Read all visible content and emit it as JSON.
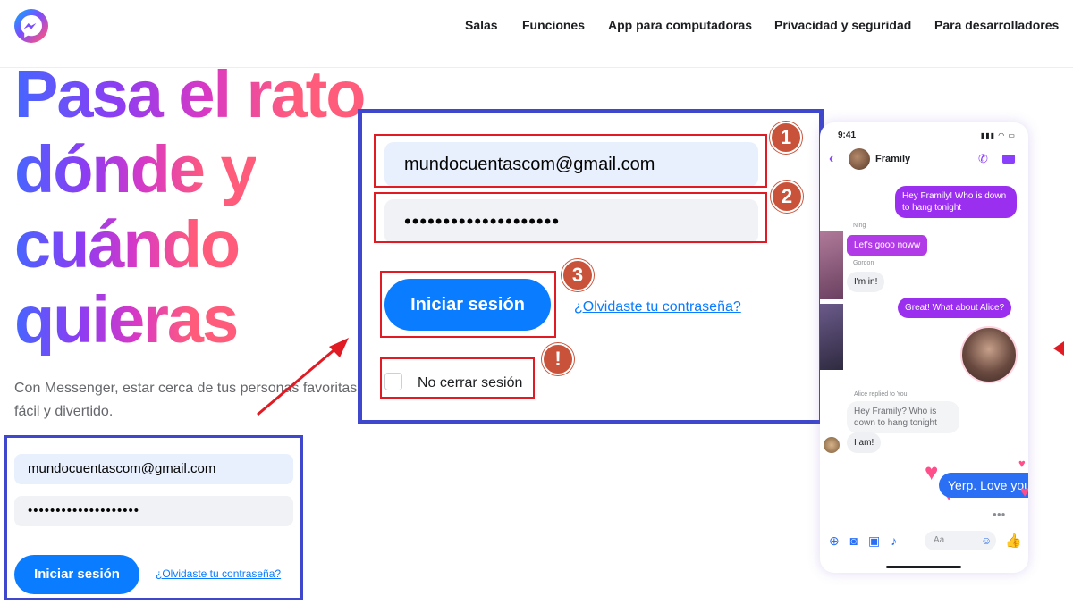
{
  "header": {
    "logo": "messenger-logo",
    "nav": [
      "Salas",
      "Funciones",
      "App para computadoras",
      "Privacidad y seguridad",
      "Para desarrolladores"
    ]
  },
  "hero": {
    "lines": [
      "Pasa el rato",
      "dónde y",
      "cuándo",
      "quieras"
    ],
    "subtitle_lines": [
      "Con Messenger, estar cerca de tus personas favoritas es",
      "fácil y divertido."
    ]
  },
  "login_small": {
    "email": "mundocuentascom@gmail.com",
    "password": "••••••••••••••••••••",
    "login_button": "Iniciar sesión",
    "forgot_link": "¿Olvidaste tu contraseña?"
  },
  "login_zoom": {
    "email": "mundocuentascom@gmail.com",
    "password": "••••••••••••••••••••",
    "login_button": "Iniciar sesión",
    "forgot_link": "¿Olvidaste tu contraseña?",
    "remember_label": "No cerrar sesión",
    "remember_checked": false
  },
  "annotations": {
    "badges": [
      "1",
      "2",
      "3",
      "!"
    ],
    "colors": {
      "highlight": "#e01b24",
      "badge": "#c9533a",
      "frame": "#3f48cc",
      "arrow": "#e01b24"
    }
  },
  "phone": {
    "time": "9:41",
    "chat_name": "Framily",
    "messages": [
      {
        "from": "me",
        "text": "Hey Framily! Who is down to hang tonight"
      },
      {
        "from": "Ning",
        "text": "Let's gooo noww"
      },
      {
        "from": "Gordon",
        "text": "I'm in!"
      },
      {
        "from": "me",
        "text": "Great! What about Alice?"
      },
      {
        "from": "Alice",
        "reply_label": "Alice replied to You",
        "quoted": "Hey Framily? Who is down to hang tonight",
        "text": "I am!"
      },
      {
        "from": "me",
        "text": "Yerp. Love you!!"
      }
    ],
    "sender_labels": {
      "ning": "Ning",
      "gordon": "Gordon"
    },
    "composer_placeholder": "Aa"
  },
  "colors": {
    "brand_blue": "#0a7cff",
    "hero_gradient": [
      "#4666ff",
      "#8e3cf2",
      "#d939c4",
      "#ff5c7c"
    ],
    "bubble_purple": "#9a2ff0"
  }
}
